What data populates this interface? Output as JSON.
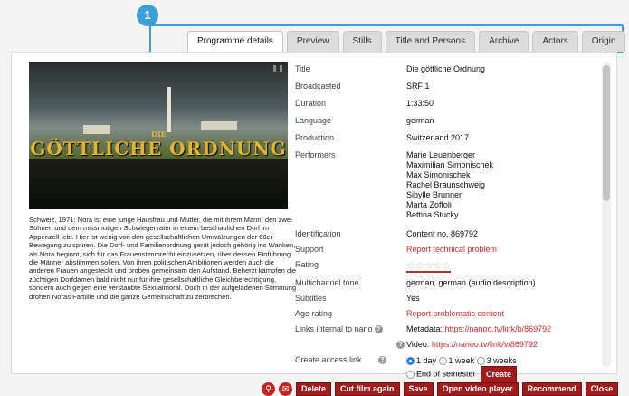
{
  "badge": "1",
  "tabs": [
    {
      "label": "Programme details"
    },
    {
      "label": "Preview"
    },
    {
      "label": "Stills"
    },
    {
      "label": "Title and Persons"
    },
    {
      "label": "Archive"
    },
    {
      "label": "Actors"
    },
    {
      "label": "Origin"
    }
  ],
  "video": {
    "overlay_small": "DIE",
    "overlay_title": "GÖTTLICHE ORDNUNG"
  },
  "description": "Schweiz, 1971: Nora ist eine junge Hausfrau und Mutter, die mit ihrem Mann, den zwei Söhnen und dem missmutigen Schwiegervater in einem beschaulichen Dorf im Appenzell lebt. Hier ist wenig von den gesellschaftlichen Umwälzungen der 68er-Bewegung zu spüren. Die Dorf- und Familienordnung gerät jedoch gehörig ins Wanken, als Nora beginnt, sich für das Frauenstimmrecht einzusetzen, über dessen Einführung die Männer abstimmen sollen. Von ihren politischen Ambitionen werden auch die anderen Frauen angesteckt und proben gemeinsam den Aufstand. Beherzt kämpfen die züchtigen Dorfdamen bald nicht nur für ihre gesellschaftliche Gleichberechtigung, sondern auch gegen eine verstaubte Sexualmoral. Doch in der aufgeladenen Stimmung drohen Noras Familie und die ganze Gemeinschaft zu zerbrechen.",
  "meta": {
    "title_label": "Title",
    "title_value": "Die göttliche Ordnung",
    "broadcasted_label": "Broadcasted",
    "broadcasted_value": "SRF 1",
    "duration_label": "Duration",
    "duration_value": "1:33:50",
    "language_label": "Language",
    "language_value": "german",
    "production_label": "Production",
    "production_value": "Switzerland 2017",
    "performers_label": "Performers",
    "performers": [
      "Marie Leuenberger",
      "Maximilian Simonischek",
      "Max Simonischek",
      "Rachel Braunschweig",
      "Sibylle Brunner",
      "Marta Zoffoli",
      "Bettina Stucky"
    ],
    "identification_label": "Identification",
    "identification_value": "Content no. 869792",
    "support_label": "Support",
    "support_link": "Report technical problem",
    "rating_label": "Rating",
    "rating_stars": "☆☆☆☆☆",
    "multichannel_label": "Multichannel tone",
    "multichannel_value": "german, german (audio description)",
    "subtitles_label": "Subtitles",
    "subtitles_value": "Yes",
    "age_label": "Age rating",
    "age_link": "Report problematic content",
    "links_label": "Links internal to nano",
    "metadata_prefix": "Metadata: ",
    "metadata_url": "https://nanoo.tv/link/b/869792",
    "video_prefix": "Video: ",
    "video_url": "https://nanoo.tv/link/v/869792",
    "access_label": "Create access link",
    "options": [
      "1 day",
      "1 week",
      "3 weeks",
      "End of semester"
    ],
    "create_label": "Create",
    "help_glyph": "?"
  },
  "actions": {
    "search_glyph": "⚲",
    "mail_glyph": "✉",
    "delete": "Delete",
    "cut": "Cut film again",
    "save": "Save",
    "open_player": "Open video player",
    "recommend": "Recommend",
    "close": "Close"
  },
  "colors": {
    "accent": "#a01c1c",
    "link": "#e02b2b",
    "highlight": "#3aa0d8"
  }
}
